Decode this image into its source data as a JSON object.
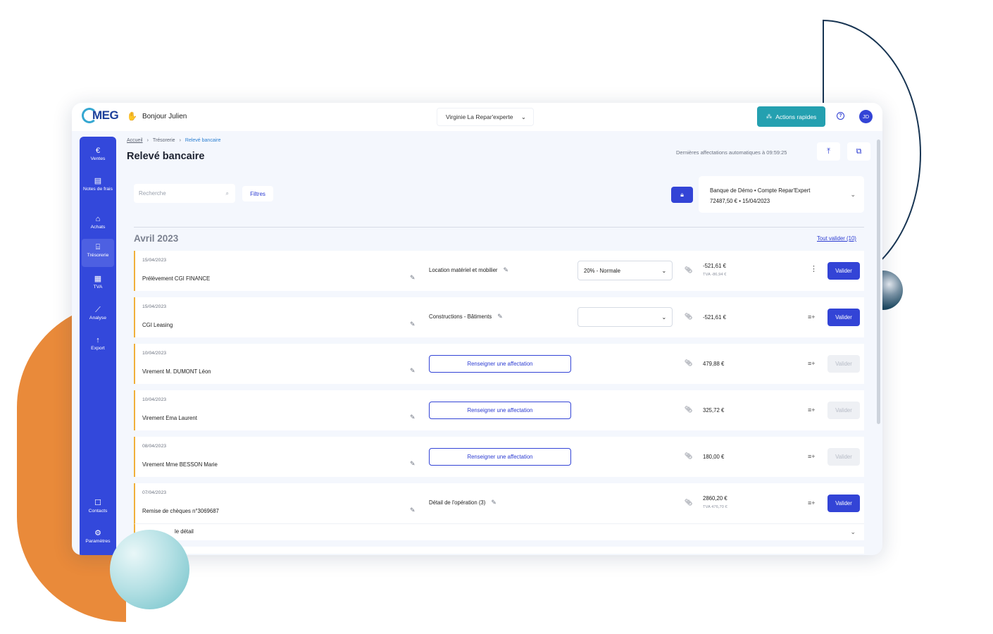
{
  "topbar": {
    "logo": "MEG",
    "greeting": "Bonjour Julien",
    "company": "Virginie La Repar'experte",
    "quick_actions": "Actions rapides",
    "help_icon": "help-circle-icon",
    "avatar": "JD"
  },
  "sidebar": {
    "items": [
      {
        "label": "Ventes",
        "icon": "€"
      },
      {
        "label": "Notes de frais",
        "icon": "▤"
      },
      {
        "label": "Achats",
        "icon": "⌂"
      },
      {
        "label": "Trésorerie",
        "icon": "⌸"
      },
      {
        "label": "TVA",
        "icon": "▦"
      },
      {
        "label": "Analyse",
        "icon": "⟋"
      },
      {
        "label": "Export",
        "icon": "↑"
      }
    ],
    "bottom_items": [
      {
        "label": "Contacts",
        "icon": "☐"
      },
      {
        "label": "Paramètres",
        "icon": "⚙"
      }
    ]
  },
  "breadcrumb": {
    "home": "Accueil",
    "section": "Trésorerie",
    "current": "Relevé bancaire"
  },
  "page": {
    "title": "Relevé bancaire",
    "last_auto": "Dernières affectations automatiques à 09:59:25",
    "search_placeholder": "Recherche",
    "filters": "Filtres"
  },
  "bank": {
    "line1": "Banque de Démo  •  Compte Repar'Expert",
    "line2": "72487,50 €  •  15/04/2023"
  },
  "month": {
    "label": "Avril 2023",
    "validate_all": "Tout valider (10)"
  },
  "rows": [
    {
      "date": "15/04/2023",
      "label": "Prélèvement CGI FINANCE",
      "category": "Location matériel et mobilier",
      "vat": "20% - Normale",
      "amount": "-521,61 €",
      "tva": "TVA -86,94 €",
      "validate": "Valider"
    },
    {
      "date": "15/04/2023",
      "label": "CGI Leasing",
      "category": "Constructions - Bâtiments",
      "vat": "",
      "amount": "-521,61 €",
      "validate": "Valider"
    },
    {
      "date": "10/04/2023",
      "label": "Virement M. DUMONT Léon",
      "assign": "Renseigner une affectation",
      "amount": "479,88 €",
      "validate": "Valider"
    },
    {
      "date": "10/04/2023",
      "label": "Virement Ema Laurent",
      "assign": "Renseigner une affectation",
      "amount": "325,72 €",
      "validate": "Valider"
    },
    {
      "date": "08/04/2023",
      "label": "Virement Mme BESSON Marie",
      "assign": "Renseigner une affectation",
      "amount": "180,00 €",
      "validate": "Valider"
    },
    {
      "date": "07/04/2023",
      "label": "Remise de chèques n°3069687",
      "category": "Détail de l'opération (3)",
      "amount": "2860,20 €",
      "tva": "TVA 476,70 €",
      "validate": "Valider"
    }
  ],
  "detail_bar": "le détail",
  "colors": {
    "primary": "#3344d6",
    "teal": "#24a0b0",
    "orange": "#e98a3a",
    "row_accent": "#f0b03a"
  }
}
